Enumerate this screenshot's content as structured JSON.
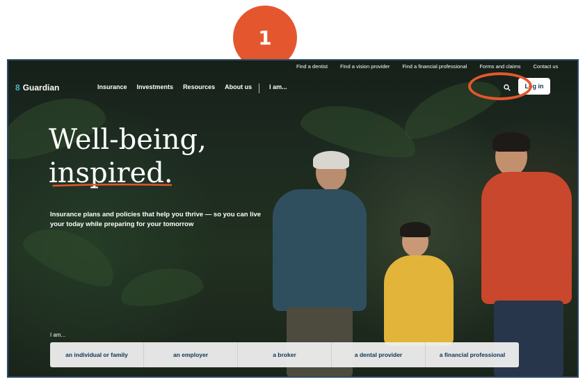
{
  "annotation": {
    "step_number": "1"
  },
  "utility_nav": [
    "Find a dentist",
    "Find a vision provider",
    "Find a financial professional",
    "Forms and claims",
    "Contact us"
  ],
  "brand": {
    "name": "Guardian"
  },
  "main_nav": {
    "items": [
      "Insurance",
      "Investments",
      "Resources",
      "About us"
    ],
    "iam": "I am...",
    "login": "Log in"
  },
  "hero": {
    "headline_line1": "Well-being,",
    "headline_line2": "inspired.",
    "subtext": "Insurance plans and policies that help you thrive — so you can live your today while preparing for your tomorrow"
  },
  "audience": {
    "label": "I am...",
    "options": [
      "an individual or family",
      "an employer",
      "a broker",
      "a dental provider",
      "a financial professional"
    ]
  },
  "colors": {
    "accent": "#e4572e",
    "frame": "#2d4d6a",
    "brand_dark": "#0d3554"
  }
}
